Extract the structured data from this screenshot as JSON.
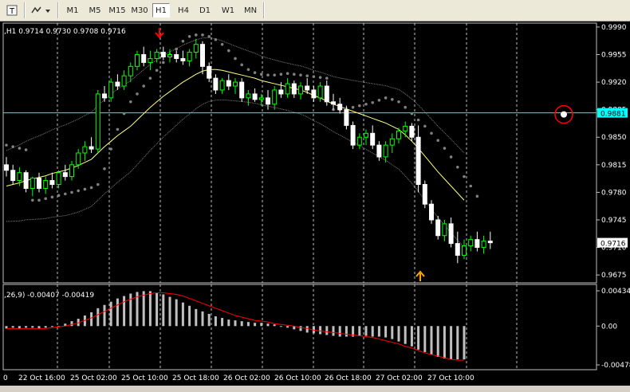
{
  "toolbar": {
    "icons": [
      "text-tool-icon",
      "objects-dropdown-icon"
    ],
    "timeframes": [
      "M1",
      "M5",
      "M15",
      "M30",
      "H1",
      "H4",
      "D1",
      "W1",
      "MN"
    ],
    "active_timeframe": "H1"
  },
  "main_info": ",H1  0.9714 0.9730 0.9708 0.9716",
  "macd_info": ",26,9) -0.00407 -0.00419",
  "price_axis": [
    "0.9990",
    "0.9955",
    "0.9920",
    "0.9885",
    "0.9850",
    "0.9815",
    "0.9780",
    "0.9745",
    "0.9710",
    "0.9675"
  ],
  "hline_label": "0.9881",
  "last_price_label": "0.9716",
  "macd_axis": [
    "0.00434",
    "0.00",
    "-0.00478"
  ],
  "time_axis": [
    "0",
    "22 Oct 16:00",
    "25 Oct 02:00",
    "25 Oct 10:00",
    "25 Oct 18:00",
    "26 Oct 02:00",
    "26 Oct 10:00",
    "26 Oct 18:00",
    "27 Oct 02:00",
    "27 Oct 10:00"
  ],
  "colors": {
    "bull": "#00ff00",
    "bear": "#ffffff",
    "ma": "#ffff80",
    "sar": "#808080",
    "hline": "#00ffff",
    "macd_hist": "#c0c0c0",
    "signal": "#ff0000",
    "arrow_down": "#ff0000",
    "arrow_up": "#ffa500"
  },
  "chart_data": {
    "type": "candlestick",
    "ylim": [
      0.9665,
      0.9995
    ],
    "candles": [
      [
        0.9815,
        0.9825,
        0.98,
        0.9808
      ],
      [
        0.9808,
        0.9815,
        0.979,
        0.9795
      ],
      [
        0.9795,
        0.9812,
        0.9788,
        0.9805
      ],
      [
        0.9805,
        0.9808,
        0.978,
        0.9785
      ],
      [
        0.9785,
        0.98,
        0.9775,
        0.9798
      ],
      [
        0.9798,
        0.9805,
        0.978,
        0.9785
      ],
      [
        0.9785,
        0.98,
        0.9778,
        0.9795
      ],
      [
        0.9795,
        0.9805,
        0.9785,
        0.979
      ],
      [
        0.979,
        0.9808,
        0.9785,
        0.9805
      ],
      [
        0.9805,
        0.9815,
        0.9795,
        0.98
      ],
      [
        0.98,
        0.982,
        0.9795,
        0.9815
      ],
      [
        0.9815,
        0.9835,
        0.981,
        0.983
      ],
      [
        0.983,
        0.9845,
        0.982,
        0.9838
      ],
      [
        0.9838,
        0.985,
        0.983,
        0.9835
      ],
      [
        0.9835,
        0.991,
        0.983,
        0.9905
      ],
      [
        0.9905,
        0.9915,
        0.9895,
        0.99
      ],
      [
        0.99,
        0.9925,
        0.9895,
        0.992
      ],
      [
        0.992,
        0.993,
        0.991,
        0.9915
      ],
      [
        0.9915,
        0.9935,
        0.991,
        0.9928
      ],
      [
        0.9928,
        0.9945,
        0.992,
        0.994
      ],
      [
        0.994,
        0.996,
        0.9935,
        0.9955
      ],
      [
        0.9955,
        0.9965,
        0.994,
        0.9945
      ],
      [
        0.9945,
        0.996,
        0.9935,
        0.995
      ],
      [
        0.995,
        0.9962,
        0.9945,
        0.9958
      ],
      [
        0.9958,
        0.9965,
        0.9948,
        0.9952
      ],
      [
        0.9952,
        0.9962,
        0.9945,
        0.9955
      ],
      [
        0.9955,
        0.996,
        0.9945,
        0.995
      ],
      [
        0.995,
        0.996,
        0.9942,
        0.9947
      ],
      [
        0.9947,
        0.9962,
        0.994,
        0.9958
      ],
      [
        0.9958,
        0.9975,
        0.995,
        0.9968
      ],
      [
        0.9968,
        0.9972,
        0.993,
        0.994
      ],
      [
        0.994,
        0.9945,
        0.992,
        0.9925
      ],
      [
        0.9925,
        0.993,
        0.9905,
        0.991
      ],
      [
        0.991,
        0.9925,
        0.9905,
        0.9922
      ],
      [
        0.9922,
        0.993,
        0.991,
        0.9915
      ],
      [
        0.9915,
        0.9925,
        0.9905,
        0.992
      ],
      [
        0.992,
        0.9925,
        0.9895,
        0.99
      ],
      [
        0.99,
        0.991,
        0.989,
        0.9905
      ],
      [
        0.9905,
        0.9912,
        0.9895,
        0.9898
      ],
      [
        0.9898,
        0.9905,
        0.989,
        0.99
      ],
      [
        0.99,
        0.991,
        0.9885,
        0.9892
      ],
      [
        0.9892,
        0.9915,
        0.9885,
        0.991
      ],
      [
        0.991,
        0.992,
        0.99,
        0.9905
      ],
      [
        0.9905,
        0.9925,
        0.99,
        0.9918
      ],
      [
        0.9918,
        0.9922,
        0.99,
        0.9905
      ],
      [
        0.9905,
        0.992,
        0.9898,
        0.9915
      ],
      [
        0.9915,
        0.9925,
        0.9905,
        0.991
      ],
      [
        0.991,
        0.9915,
        0.9895,
        0.99
      ],
      [
        0.99,
        0.992,
        0.9895,
        0.9915
      ],
      [
        0.9915,
        0.9922,
        0.989,
        0.9895
      ],
      [
        0.9895,
        0.9905,
        0.9885,
        0.9892
      ],
      [
        0.9892,
        0.99,
        0.988,
        0.9885
      ],
      [
        0.9885,
        0.989,
        0.986,
        0.9865
      ],
      [
        0.9865,
        0.987,
        0.9835,
        0.984
      ],
      [
        0.984,
        0.9855,
        0.9835,
        0.985
      ],
      [
        0.985,
        0.986,
        0.984,
        0.9855
      ],
      [
        0.9855,
        0.9865,
        0.9835,
        0.984
      ],
      [
        0.984,
        0.9845,
        0.982,
        0.9825
      ],
      [
        0.9825,
        0.9845,
        0.9818,
        0.984
      ],
      [
        0.984,
        0.9855,
        0.983,
        0.9848
      ],
      [
        0.9848,
        0.9862,
        0.9842,
        0.9858
      ],
      [
        0.9858,
        0.987,
        0.985,
        0.9864
      ],
      [
        0.9864,
        0.9868,
        0.9845,
        0.985
      ],
      [
        0.985,
        0.9865,
        0.978,
        0.979
      ],
      [
        0.979,
        0.9795,
        0.976,
        0.9765
      ],
      [
        0.9765,
        0.977,
        0.974,
        0.9745
      ],
      [
        0.9745,
        0.975,
        0.972,
        0.9725
      ],
      [
        0.9725,
        0.9745,
        0.9718,
        0.974
      ],
      [
        0.974,
        0.9748,
        0.971,
        0.9715
      ],
      [
        0.9715,
        0.973,
        0.969,
        0.97
      ],
      [
        0.97,
        0.972,
        0.9695,
        0.9712
      ],
      [
        0.9712,
        0.9725,
        0.9705,
        0.972
      ],
      [
        0.972,
        0.973,
        0.9705,
        0.971
      ],
      [
        0.971,
        0.9725,
        0.9702,
        0.9718
      ],
      [
        0.9718,
        0.973,
        0.9708,
        0.9716
      ]
    ],
    "ma": [
      0.9788,
      0.979,
      0.9792,
      0.9795,
      0.9797,
      0.9799,
      0.9801,
      0.9804,
      0.9806,
      0.9808,
      0.9811,
      0.9814,
      0.9818,
      0.9822,
      0.983,
      0.9838,
      0.9845,
      0.9852,
      0.9858,
      0.9864,
      0.9872,
      0.988,
      0.9888,
      0.9895,
      0.9902,
      0.9908,
      0.9914,
      0.992,
      0.9925,
      0.993,
      0.9934,
      0.9936,
      0.9936,
      0.9935,
      0.9933,
      0.9931,
      0.9929,
      0.9927,
      0.9925,
      0.9922,
      0.992,
      0.9918,
      0.9916,
      0.9914,
      0.9912,
      0.991,
      0.9907,
      0.9903,
      0.99,
      0.9896,
      0.9892,
      0.9889,
      0.9886,
      0.9883,
      0.988,
      0.9877,
      0.9874,
      0.9871,
      0.9868,
      0.9864,
      0.986,
      0.9853,
      0.9845,
      0.9836,
      0.9826,
      0.9816,
      0.9806,
      0.9797,
      0.9788,
      0.9779,
      0.977
    ],
    "sar": [
      0.984,
      0.9838,
      0.9836,
      0.9834,
      0.977,
      0.977,
      0.9772,
      0.9774,
      0.9776,
      0.9778,
      0.978,
      0.9782,
      0.9784,
      0.9786,
      0.979,
      0.981,
      0.9835,
      0.986,
      0.988,
      0.9895,
      0.9905,
      0.9915,
      0.9925,
      0.9935,
      0.9945,
      0.9955,
      0.9962,
      0.9972,
      0.9978,
      0.998,
      0.998,
      0.9978,
      0.9974,
      0.9968,
      0.996,
      0.995,
      0.9942,
      0.9936,
      0.9932,
      0.993,
      0.9929,
      0.9929,
      0.993,
      0.9931,
      0.993,
      0.9929,
      0.9928,
      0.9927,
      0.9926,
      0.9925,
      0.9885,
      0.9885,
      0.9886,
      0.9888,
      0.989,
      0.9892,
      0.9894,
      0.9897,
      0.99,
      0.9898,
      0.9895,
      0.9888,
      0.988,
      0.9872,
      0.9864,
      0.9855,
      0.9846,
      0.9836,
      0.9825,
      0.9812,
      0.98,
      0.9788,
      0.9775
    ],
    "macd": [
      -0.0003,
      -0.0002,
      -0.0003,
      -0.0002,
      -0.0002,
      -0.0003,
      -0.0002,
      -0.0001,
      0.0,
      0.0003,
      0.0006,
      0.0009,
      0.0013,
      0.0017,
      0.0022,
      0.0026,
      0.003,
      0.0034,
      0.0037,
      0.004,
      0.0042,
      0.0043,
      0.0043,
      0.0041,
      0.0039,
      0.0036,
      0.0033,
      0.0029,
      0.0025,
      0.0021,
      0.0018,
      0.0015,
      0.0012,
      0.001,
      0.0008,
      0.0007,
      0.0006,
      0.0005,
      0.0004,
      0.0004,
      0.0003,
      0.0002,
      0.0,
      -0.0002,
      -0.0004,
      -0.0006,
      -0.0008,
      -0.0009,
      -0.001,
      -0.0011,
      -0.0012,
      -0.0013,
      -0.0013,
      -0.0013,
      -0.0012,
      -0.0012,
      -0.0013,
      -0.0013,
      -0.0014,
      -0.0016,
      -0.0019,
      -0.0022,
      -0.0025,
      -0.0029,
      -0.0032,
      -0.0035,
      -0.0038,
      -0.004,
      -0.0041,
      -0.0041,
      -0.0041
    ],
    "signal": [
      -0.0003,
      -0.0003,
      -0.0003,
      -0.0003,
      -0.0003,
      -0.0003,
      -0.0003,
      -0.0002,
      -0.0001,
      0.0,
      0.0002,
      0.0004,
      0.0007,
      0.001,
      0.0014,
      0.0018,
      0.0022,
      0.0026,
      0.003,
      0.0033,
      0.0036,
      0.0038,
      0.004,
      0.0041,
      0.0041,
      0.004,
      0.0039,
      0.0037,
      0.0034,
      0.0031,
      0.0028,
      0.0025,
      0.0022,
      0.0019,
      0.0016,
      0.0013,
      0.0011,
      0.0009,
      0.0007,
      0.0006,
      0.0005,
      0.0003,
      0.0002,
      0.0001,
      0.0,
      -0.0002,
      -0.0003,
      -0.0005,
      -0.0006,
      -0.0007,
      -0.0008,
      -0.0009,
      -0.001,
      -0.0011,
      -0.0012,
      -0.0013,
      -0.0014,
      -0.0016,
      -0.0018,
      -0.002,
      -0.0022,
      -0.0025,
      -0.0027,
      -0.003,
      -0.0033,
      -0.0035,
      -0.0037,
      -0.0039,
      -0.0041,
      -0.0042,
      -0.0042
    ],
    "macd_ylim": [
      -0.00478,
      0.00434
    ]
  }
}
